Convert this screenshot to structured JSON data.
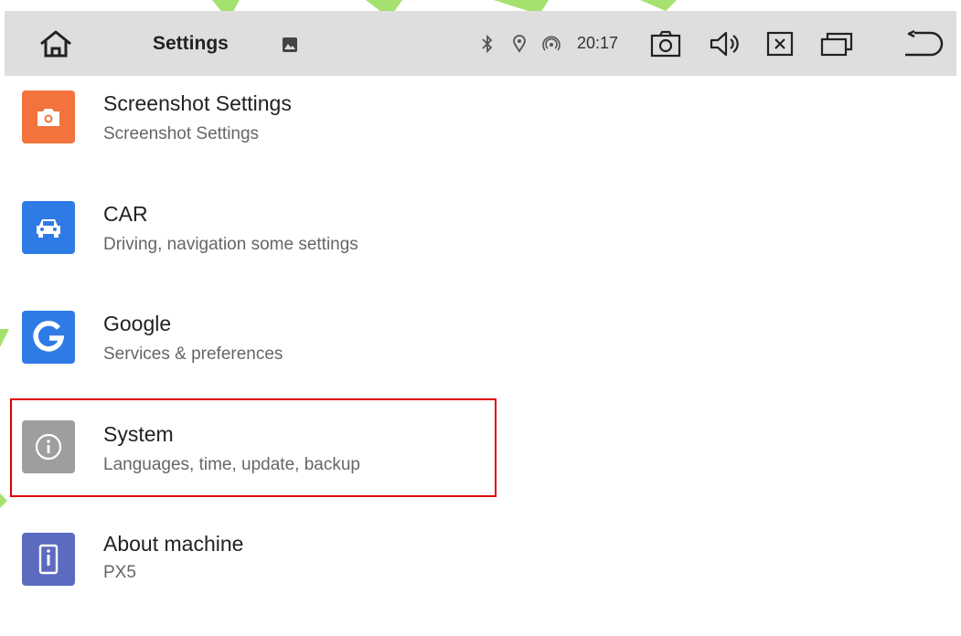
{
  "header": {
    "title": "Settings",
    "time": "20:17"
  },
  "icons": {
    "home": "home-icon",
    "notification": "image-notification-icon",
    "bluetooth": "bluetooth-icon",
    "location": "location-icon",
    "hotspot": "hotspot-icon",
    "screenshot": "camera-icon",
    "volume": "volume-icon",
    "close": "close-icon",
    "recents": "recent-apps-icon",
    "back": "back-icon"
  },
  "settings": [
    {
      "title": "Screenshot Settings",
      "subtitle": "Screenshot Settings",
      "icon": "camera-icon",
      "color": "#f2733b"
    },
    {
      "title": "CAR",
      "subtitle": "Driving, navigation some settings",
      "icon": "car-icon",
      "color": "#2f7be6"
    },
    {
      "title": "Google",
      "subtitle": "Services & preferences",
      "icon": "google-icon",
      "color": "#2f7be6"
    },
    {
      "title": "System",
      "subtitle": "Languages, time, update, backup",
      "icon": "info-icon",
      "color": "#9e9e9e",
      "highlighted": true
    },
    {
      "title": "About machine",
      "subtitle": "PX5",
      "icon": "device-icon",
      "color": "#5c6bc0"
    }
  ],
  "colors": {
    "statusbar_bg": "#dedede",
    "highlight_border": "#e00000",
    "watermark": "#8ed94a"
  }
}
